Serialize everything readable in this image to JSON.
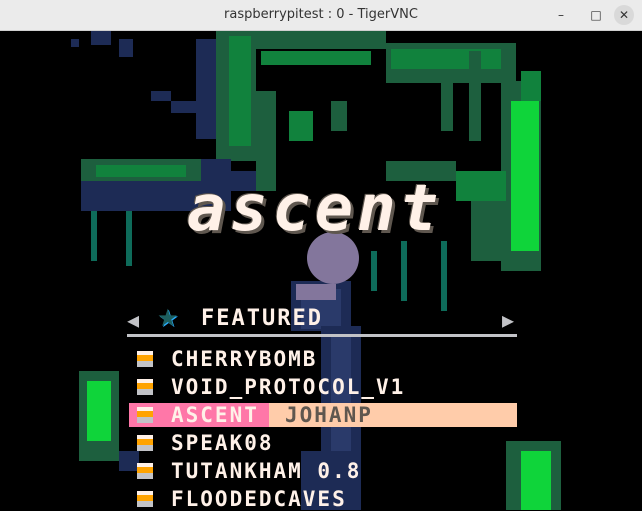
{
  "window": {
    "title": "raspberrypitest : 0 - TigerVNC",
    "controls": {
      "minimize": "–",
      "maximize": "□",
      "close": "✕"
    }
  },
  "game": {
    "logo_text": "ascent",
    "category": "FEATURED",
    "nav_icons": {
      "prev": "◀",
      "next": "▶",
      "star": "★"
    },
    "carts": [
      {
        "title": "CHERRYBOMB",
        "author": "",
        "selected": false
      },
      {
        "title": "VOID_PROTOCOL_V1",
        "author": "",
        "selected": false
      },
      {
        "title": "ASCENT",
        "author": "JOHANP",
        "selected": true
      },
      {
        "title": "SPEAK08",
        "author": "",
        "selected": false
      },
      {
        "title": "TUTANKHAM 0.8",
        "author": "",
        "selected": false
      },
      {
        "title": "FLOODEDCAVES",
        "author": "",
        "selected": false
      }
    ]
  },
  "colors": {
    "selection_primary": "#ff77a8",
    "selection_secondary": "#ffccaa",
    "text": "#fff1e8",
    "cart_icon": "#ffa300"
  }
}
